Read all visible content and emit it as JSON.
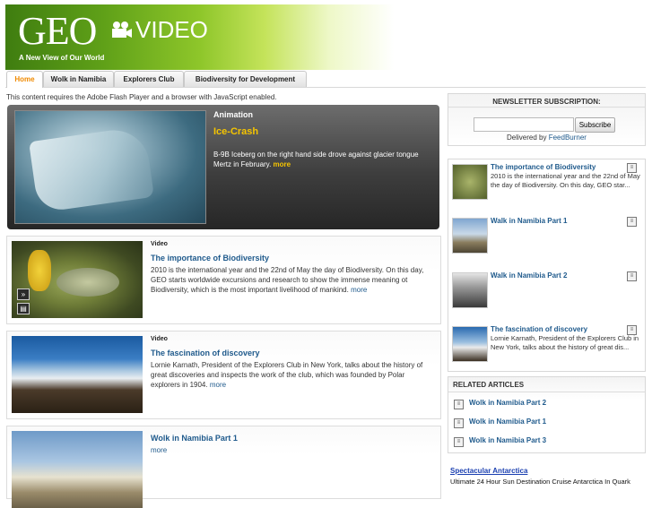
{
  "header": {
    "logo": "GEO",
    "video_label": "VIDEO",
    "tagline": "A New View of Our World"
  },
  "nav": {
    "tabs": [
      {
        "label": "Home",
        "active": true
      },
      {
        "label": "Wolk in Namibia"
      },
      {
        "label": "Explorers Club"
      },
      {
        "label": "Biodiversity for Development"
      }
    ]
  },
  "flash_notice": "This content requires the Adobe Flash Player and a browser with JavaScript enabled.",
  "featured": {
    "category": "Animation",
    "title": "Ice-Crash",
    "description": "B-9B Iceberg on the right hand side drove against glacier tongue Mertz in February.",
    "more": "more"
  },
  "videos": [
    {
      "category": "Video",
      "title": "The importance of Biodiversity",
      "description": "2010 is the international year and the 22nd of May the day of Biodiversity. On this day, GEO starts worldwide excursions and research to show the immense meaning ot Biodiversity, which is the most important livelihood of mankind.",
      "more": "more"
    },
    {
      "category": "Video",
      "title": "The fascination of discovery",
      "description": "Lornie Karnath, President of the Explorers Club in New York, talks about the history of great discoveries and inspects the work of the club, which was founded by Polar explorers in 1904.",
      "more": "more"
    },
    {
      "category": "",
      "title": "Wolk in Namibia Part 1",
      "description": "",
      "more": "more"
    }
  ],
  "newsletter": {
    "heading": "NEWSLETTER SUBSCRIPTION:",
    "input_value": "",
    "button": "Subscribe",
    "delivered_by": "Delivered by",
    "provider": "FeedBurner"
  },
  "sidebar_videos": [
    {
      "title": "The importance of Biodiversity",
      "description": "2010 is the international year and the 22nd of May the day of Biodiversity. On this day, GEO star..."
    },
    {
      "title": "Walk in Namibia Part 1",
      "description": ""
    },
    {
      "title": "Walk in Namibia Part 2",
      "description": ""
    },
    {
      "title": "The fascination of discovery",
      "description": "Lornie Karnath, President of the Explorers Club in New York, talks about the history of great dis..."
    }
  ],
  "related": {
    "heading": "RELATED ARTICLES",
    "items": [
      "Wolk in Namibia Part 2",
      "Wolk in Namibia Part 1",
      "Wolk in Namibia Part 3"
    ]
  },
  "ad": {
    "title": "Spectacular Antarctica",
    "text": "Ultimate 24 Hour Sun Destination Cruise Antarctica In Quark"
  },
  "icons": {
    "camera": "video-camera-icon",
    "article": "article-icon",
    "share": "share-icon",
    "grid": "grid-icon"
  },
  "colors": {
    "accent_orange": "#f08a00",
    "link_blue": "#1f5a8c",
    "highlight_yellow": "#f5c400",
    "banner_green": "#5fa018"
  }
}
